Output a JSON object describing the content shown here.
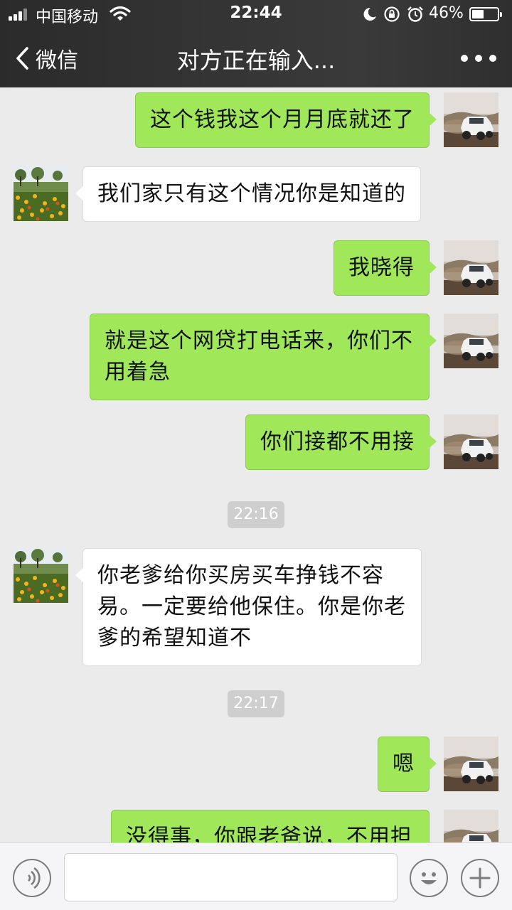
{
  "status_bar": {
    "carrier": "中国移动",
    "time": "22:44",
    "battery_percent": "46%",
    "battery_level": 0.46,
    "signal_bars": 3,
    "icons": [
      "signal-icon",
      "wifi-icon",
      "moon-icon",
      "rotation-lock-icon",
      "alarm-icon",
      "battery-icon"
    ]
  },
  "nav": {
    "back_label": "微信",
    "title": "对方正在输入...",
    "more_icon": "more-dots-icon"
  },
  "messages": [
    {
      "side": "out",
      "text": "这个钱我这个月月底就还了"
    },
    {
      "side": "in",
      "text": "我们家只有这个情况你是知道的"
    },
    {
      "side": "out",
      "text": "我晓得"
    },
    {
      "side": "out",
      "text": "就是这个网贷打电话来，你们不\n用着急"
    },
    {
      "side": "out",
      "text": "你们接都不用接"
    },
    {
      "type": "time",
      "text": "22:16"
    },
    {
      "side": "in",
      "text": "你老爹给你买房买车挣钱不容\n易。一定要给他保住。你是你老\n爹的希望知道不"
    },
    {
      "type": "time",
      "text": "22:17"
    },
    {
      "side": "out",
      "text": "嗯"
    },
    {
      "side": "out",
      "text": "没得事，你跟老爸说，不用担"
    }
  ],
  "input_bar": {
    "voice_icon": "voice-icon",
    "text_value": "",
    "emoji_icon": "emoji-icon",
    "plus_icon": "plus-icon"
  },
  "colors": {
    "outgoing_bubble": "#a0e75a",
    "incoming_bubble": "#ffffff",
    "chat_background": "#ebebeb",
    "header": "#333333"
  }
}
